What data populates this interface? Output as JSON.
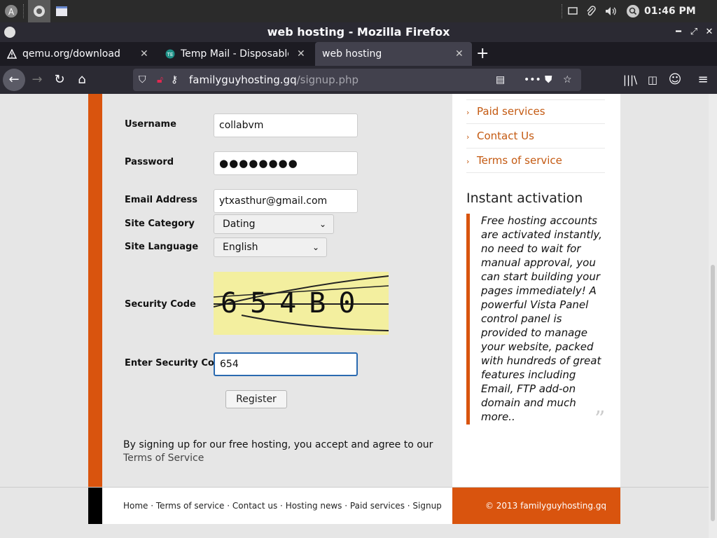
{
  "desktop": {
    "clock": "01:46 PM"
  },
  "window": {
    "title": "web hosting - Mozilla Firefox"
  },
  "tabs": [
    {
      "label": "qemu.org/download",
      "icon": "warning-icon"
    },
    {
      "label": "Temp Mail - Disposable T",
      "icon": "tempmail-icon"
    },
    {
      "label": "web hosting",
      "icon": "none"
    }
  ],
  "urlbar": {
    "host": "familyguyhosting.gq",
    "path": "/signup.php"
  },
  "form": {
    "username_label": "Username",
    "username_value": "collabvm",
    "password_label": "Password",
    "password_value": "●●●●●●●●",
    "email_label": "Email Address",
    "email_value": "ytxasthur@gmail.com",
    "category_label": "Site Category",
    "category_value": "Dating",
    "language_label": "Site Language",
    "language_value": "English",
    "security_label": "Security Code",
    "captcha_text": "654B0",
    "enter_code_label": "Enter Security Code",
    "enter_code_value": "654",
    "register_label": "Register",
    "agree_text": "By signing up for our free hosting, you accept and agree to our",
    "tos_link": "Terms of Service"
  },
  "sidebar": {
    "links": [
      "Paid services",
      "Contact Us",
      "Terms of service"
    ],
    "heading": "Instant activation",
    "quote": "Free hosting accounts are activated instantly, no need to wait for manual approval, you can start building your pages immediately! A powerful Vista Panel control panel is provided to manage your website, packed with hundreds of great features including Email, FTP add-on domain and much more.."
  },
  "footer": {
    "links": [
      "Home",
      "Terms of service",
      "Contact us",
      "Hosting news",
      "Paid services",
      "Signup"
    ],
    "copyright": "© 2013 familyguyhosting.gq"
  },
  "colors": {
    "accent": "#d9540e",
    "link": "#c45a12"
  }
}
